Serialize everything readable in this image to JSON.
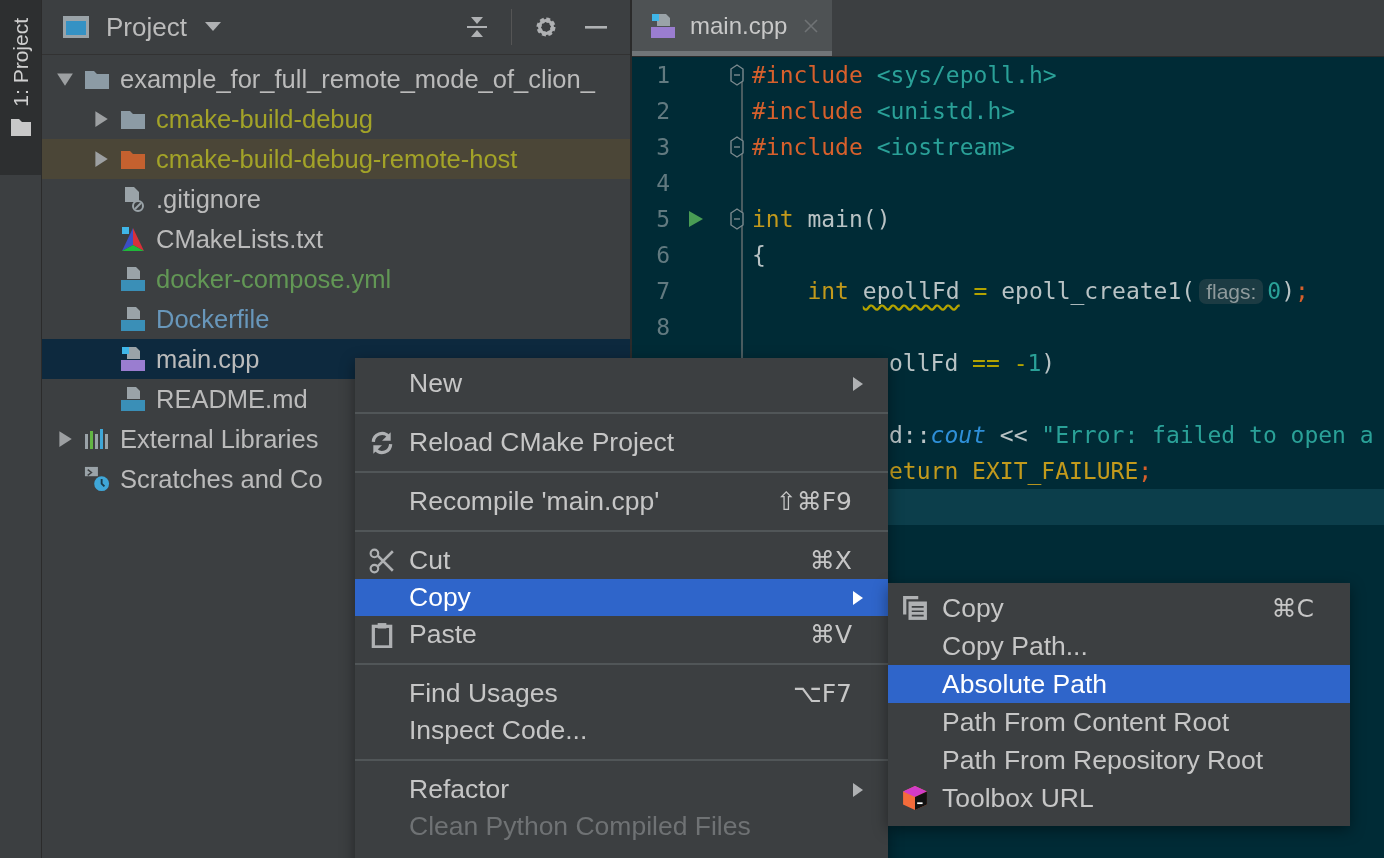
{
  "tool_strip": {
    "tab": {
      "label": "1: Project",
      "selected": true
    }
  },
  "project_panel": {
    "title": "Project"
  },
  "tree": [
    {
      "label": "example_for_full_remote_mode_of_clion_",
      "kind": "folder",
      "expanded": true,
      "selected": false,
      "highlighted": false,
      "children": [
        {
          "label": "cmake-build-debug",
          "kind": "folder",
          "expanded": false,
          "selected": false,
          "highlighted": false,
          "color": "#a3a328"
        },
        {
          "label": "cmake-build-debug-remote-host",
          "kind": "excluded-folder",
          "expanded": false,
          "selected": false,
          "highlighted": true,
          "color": "#a3a328"
        },
        {
          "label": ".gitignore",
          "kind": "ignore",
          "selected": false,
          "highlighted": false
        },
        {
          "label": "CMakeLists.txt",
          "kind": "cmake",
          "selected": false,
          "highlighted": false
        },
        {
          "label": "docker-compose.yml",
          "kind": "compose",
          "selected": false,
          "highlighted": false,
          "color": "#629755"
        },
        {
          "label": "Dockerfile",
          "kind": "docker",
          "selected": false,
          "highlighted": false,
          "color": "#6897bb"
        },
        {
          "label": "main.cpp",
          "kind": "cpp",
          "selected": true,
          "highlighted": false
        },
        {
          "label": "README.md",
          "kind": "markdown",
          "selected": false,
          "highlighted": false
        }
      ]
    },
    {
      "label": "External Libraries",
      "kind": "libraries",
      "expanded": false,
      "selected": false,
      "highlighted": false
    },
    {
      "label": "Scratches and Co",
      "kind": "scratches",
      "selected": false,
      "highlighted": false
    }
  ],
  "editor": {
    "tab": {
      "label": "main.cpp",
      "selected": true
    },
    "lines": [
      {
        "kind": "full",
        "number": "1",
        "fold": true,
        "run": false,
        "current": false,
        "tokens": [
          {
            "text": "#include",
            "kind": "directive"
          },
          {
            "text": " <sys/epoll.h>",
            "kind": "header"
          }
        ]
      },
      {
        "kind": "full",
        "number": "2",
        "fold": false,
        "run": false,
        "current": false,
        "tokens": [
          {
            "text": "#include",
            "kind": "directive"
          },
          {
            "text": " <unistd.h>",
            "kind": "header"
          }
        ]
      },
      {
        "kind": "full",
        "number": "3",
        "fold": true,
        "run": false,
        "current": false,
        "tokens": [
          {
            "text": "#include",
            "kind": "directive"
          },
          {
            "text": " <iostream>",
            "kind": "header"
          }
        ]
      },
      {
        "kind": "full",
        "number": "4",
        "fold": false,
        "run": false,
        "current": false
      },
      {
        "kind": "full",
        "number": "5",
        "fold": true,
        "run": true,
        "current": false,
        "tokens": [
          {
            "text": "int",
            "kind": "keyword"
          },
          {
            "text": " main()",
            "kind": "plain"
          }
        ]
      },
      {
        "kind": "full",
        "number": "6",
        "fold": false,
        "run": false,
        "current": false,
        "tokens": [
          {
            "text": "{",
            "kind": "plain"
          }
        ]
      },
      {
        "kind": "full",
        "number": "7",
        "fold": false,
        "run": false,
        "current": false,
        "tokens": [
          {
            "text": "    int ",
            "kind": "keyword"
          },
          {
            "text": "epollFd",
            "kind": "warn"
          },
          {
            "text": " = ",
            "kind": "op"
          },
          {
            "text": "epoll_create1(",
            "kind": "plain"
          },
          {
            "text": "flags:",
            "kind": "hint"
          },
          {
            "text": "0",
            "kind": "number"
          },
          {
            "text": ")",
            "kind": "plain"
          },
          {
            "text": ";",
            "kind": "punct"
          }
        ]
      },
      {
        "kind": "full",
        "number": "8",
        "fold": false,
        "run": false,
        "current": false
      },
      {
        "kind": "cut",
        "current": false,
        "tokens": [
          {
            "text": "ollFd",
            "kind": "plain"
          },
          {
            "text": " == -",
            "kind": "op"
          },
          {
            "text": "1",
            "kind": "number"
          },
          {
            "text": ")",
            "kind": "plain"
          }
        ]
      },
      {
        "kind": "cut",
        "current": false
      },
      {
        "kind": "cut",
        "current": false,
        "tokens": [
          {
            "text": "d::",
            "kind": "plain"
          },
          {
            "text": "cout",
            "kind": "field"
          },
          {
            "text": " << ",
            "kind": "plain"
          },
          {
            "text": "\"Error: failed to open a",
            "kind": "string"
          }
        ]
      },
      {
        "kind": "cut",
        "current": false,
        "tokens": [
          {
            "text": "eturn ",
            "kind": "keyword"
          },
          {
            "text": "EXIT_FAILURE",
            "kind": "macro"
          },
          {
            "text": ";",
            "kind": "punct"
          }
        ]
      },
      {
        "kind": "cut",
        "current": true
      },
      {
        "kind": "cut",
        "current": false
      }
    ]
  },
  "context_menu": {
    "groups": [
      {
        "items": [
          {
            "label": "New",
            "submenu": true,
            "selected": false,
            "disabled": false
          }
        ]
      },
      {
        "items": [
          {
            "label": "Reload CMake Project",
            "kind": "reload",
            "submenu": false,
            "selected": false,
            "disabled": false
          }
        ]
      },
      {
        "items": [
          {
            "label": "Recompile 'main.cpp'",
            "shortcut": "⇧⌘F9",
            "submenu": false,
            "selected": false,
            "disabled": false
          }
        ]
      },
      {
        "items": [
          {
            "label": "Cut",
            "kind": "cut",
            "shortcut": "⌘X",
            "submenu": false,
            "selected": false,
            "disabled": false
          },
          {
            "label": "Copy",
            "submenu": true,
            "selected": true,
            "disabled": false
          },
          {
            "label": "Paste",
            "kind": "paste",
            "shortcut": "⌘V",
            "submenu": false,
            "selected": false,
            "disabled": false
          }
        ]
      },
      {
        "items": [
          {
            "label": "Find Usages",
            "shortcut": "⌥F7",
            "submenu": false,
            "selected": false,
            "disabled": false
          },
          {
            "label": "Inspect Code...",
            "submenu": false,
            "selected": false,
            "disabled": false
          }
        ]
      },
      {
        "items": [
          {
            "label": "Refactor",
            "submenu": true,
            "selected": false,
            "disabled": false
          },
          {
            "label": "Clean Python Compiled Files",
            "submenu": false,
            "selected": false,
            "disabled": true
          }
        ]
      }
    ]
  },
  "copy_submenu": {
    "items": [
      {
        "label": "Copy",
        "kind": "copy",
        "shortcut": "⌘C",
        "selected": false
      },
      {
        "label": "Copy Path...",
        "selected": false
      },
      {
        "label": "Absolute Path",
        "selected": true
      },
      {
        "label": "Path From Content Root",
        "selected": false
      },
      {
        "label": "Path From Repository Root",
        "selected": false
      },
      {
        "label": "Toolbox URL",
        "kind": "toolbox",
        "selected": false
      }
    ]
  }
}
